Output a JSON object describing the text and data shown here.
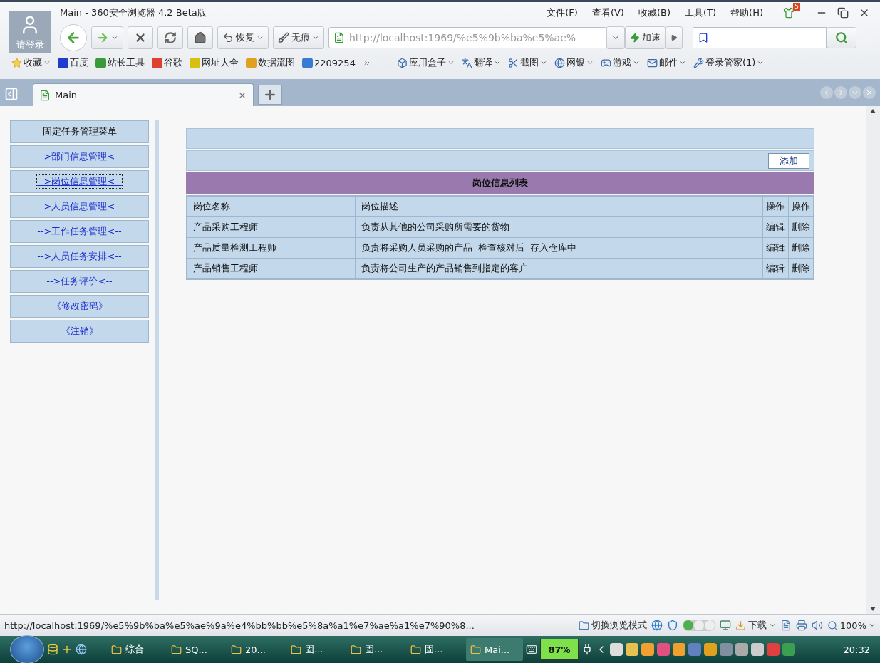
{
  "window": {
    "title": "Main - 360安全浏览器 4.2 Beta版",
    "avatar_label": "请登录",
    "notification_count": "5",
    "menu": [
      "文件(F)",
      "查看(V)",
      "收藏(B)",
      "工具(T)",
      "帮助(H)"
    ]
  },
  "toolbar": {
    "restore": "恢复",
    "incognito": "无痕",
    "address": "http://localhost:1969/%e5%9b%ba%e5%ae%",
    "accelerate": "加速"
  },
  "bookmarks": [
    {
      "label": "收藏",
      "dropdown": true
    },
    {
      "label": "百度",
      "dropdown": false
    },
    {
      "label": "站长工具",
      "dropdown": false
    },
    {
      "label": "谷歌",
      "dropdown": false
    },
    {
      "label": "网址大全",
      "dropdown": false
    },
    {
      "label": "数据流图",
      "dropdown": false
    },
    {
      "label": "2209254",
      "dropdown": false
    }
  ],
  "extensions": [
    {
      "label": "应用盒子"
    },
    {
      "label": "翻译"
    },
    {
      "label": "截图"
    },
    {
      "label": "网银"
    },
    {
      "label": "游戏"
    },
    {
      "label": "邮件"
    },
    {
      "label": "登录管家(1)"
    }
  ],
  "tabs": [
    {
      "label": "Main",
      "selected": true
    }
  ],
  "sidebar": {
    "title": "固定任务管理菜单",
    "items": [
      {
        "label": "-->部门信息管理<--",
        "focused": false
      },
      {
        "label": "-->岗位信息管理<--",
        "focused": true
      },
      {
        "label": "-->人员信息管理<--",
        "focused": false
      },
      {
        "label": "-->工作任务管理<--",
        "focused": false
      },
      {
        "label": "-->人员任务安排<--",
        "focused": false
      },
      {
        "label": "-->任务评价<--",
        "focused": false
      },
      {
        "label": "《修改密码》",
        "focused": false
      },
      {
        "label": "《注销》",
        "focused": false
      }
    ]
  },
  "content": {
    "add_button": "添加",
    "table": {
      "title": "岗位信息列表",
      "columns": [
        "岗位名称",
        "岗位描述",
        "操作",
        "操作"
      ],
      "rows": [
        [
          "产品采购工程师",
          "负责从其他的公司采购所需要的货物",
          "编辑",
          "删除"
        ],
        [
          "产品质量检测工程师",
          "负责将采购人员采购的产品  检查核对后  存入仓库中",
          "编辑",
          "删除"
        ],
        [
          "产品销售工程师",
          "负责将公司生产的产品销售到指定的客户",
          "编辑",
          "删除"
        ]
      ]
    }
  },
  "status_bar": {
    "url": "http://localhost:1969/%e5%9b%ba%e5%ae%9a%e4%bb%bb%e5%8a%a1%e7%ae%a1%e7%90%8...",
    "mode": "切换浏览模式",
    "download": "下载",
    "zoom": "100%"
  },
  "taskbar": {
    "tasks": [
      {
        "label": "综合",
        "selected": false
      },
      {
        "label": "SQ...",
        "selected": false
      },
      {
        "label": "20...",
        "selected": false
      },
      {
        "label": "固...",
        "selected": false
      },
      {
        "label": "固...",
        "selected": false
      },
      {
        "label": "固...",
        "selected": false
      },
      {
        "label": "Mai...",
        "selected": true
      }
    ],
    "battery": "87%",
    "clock": "20:32"
  }
}
